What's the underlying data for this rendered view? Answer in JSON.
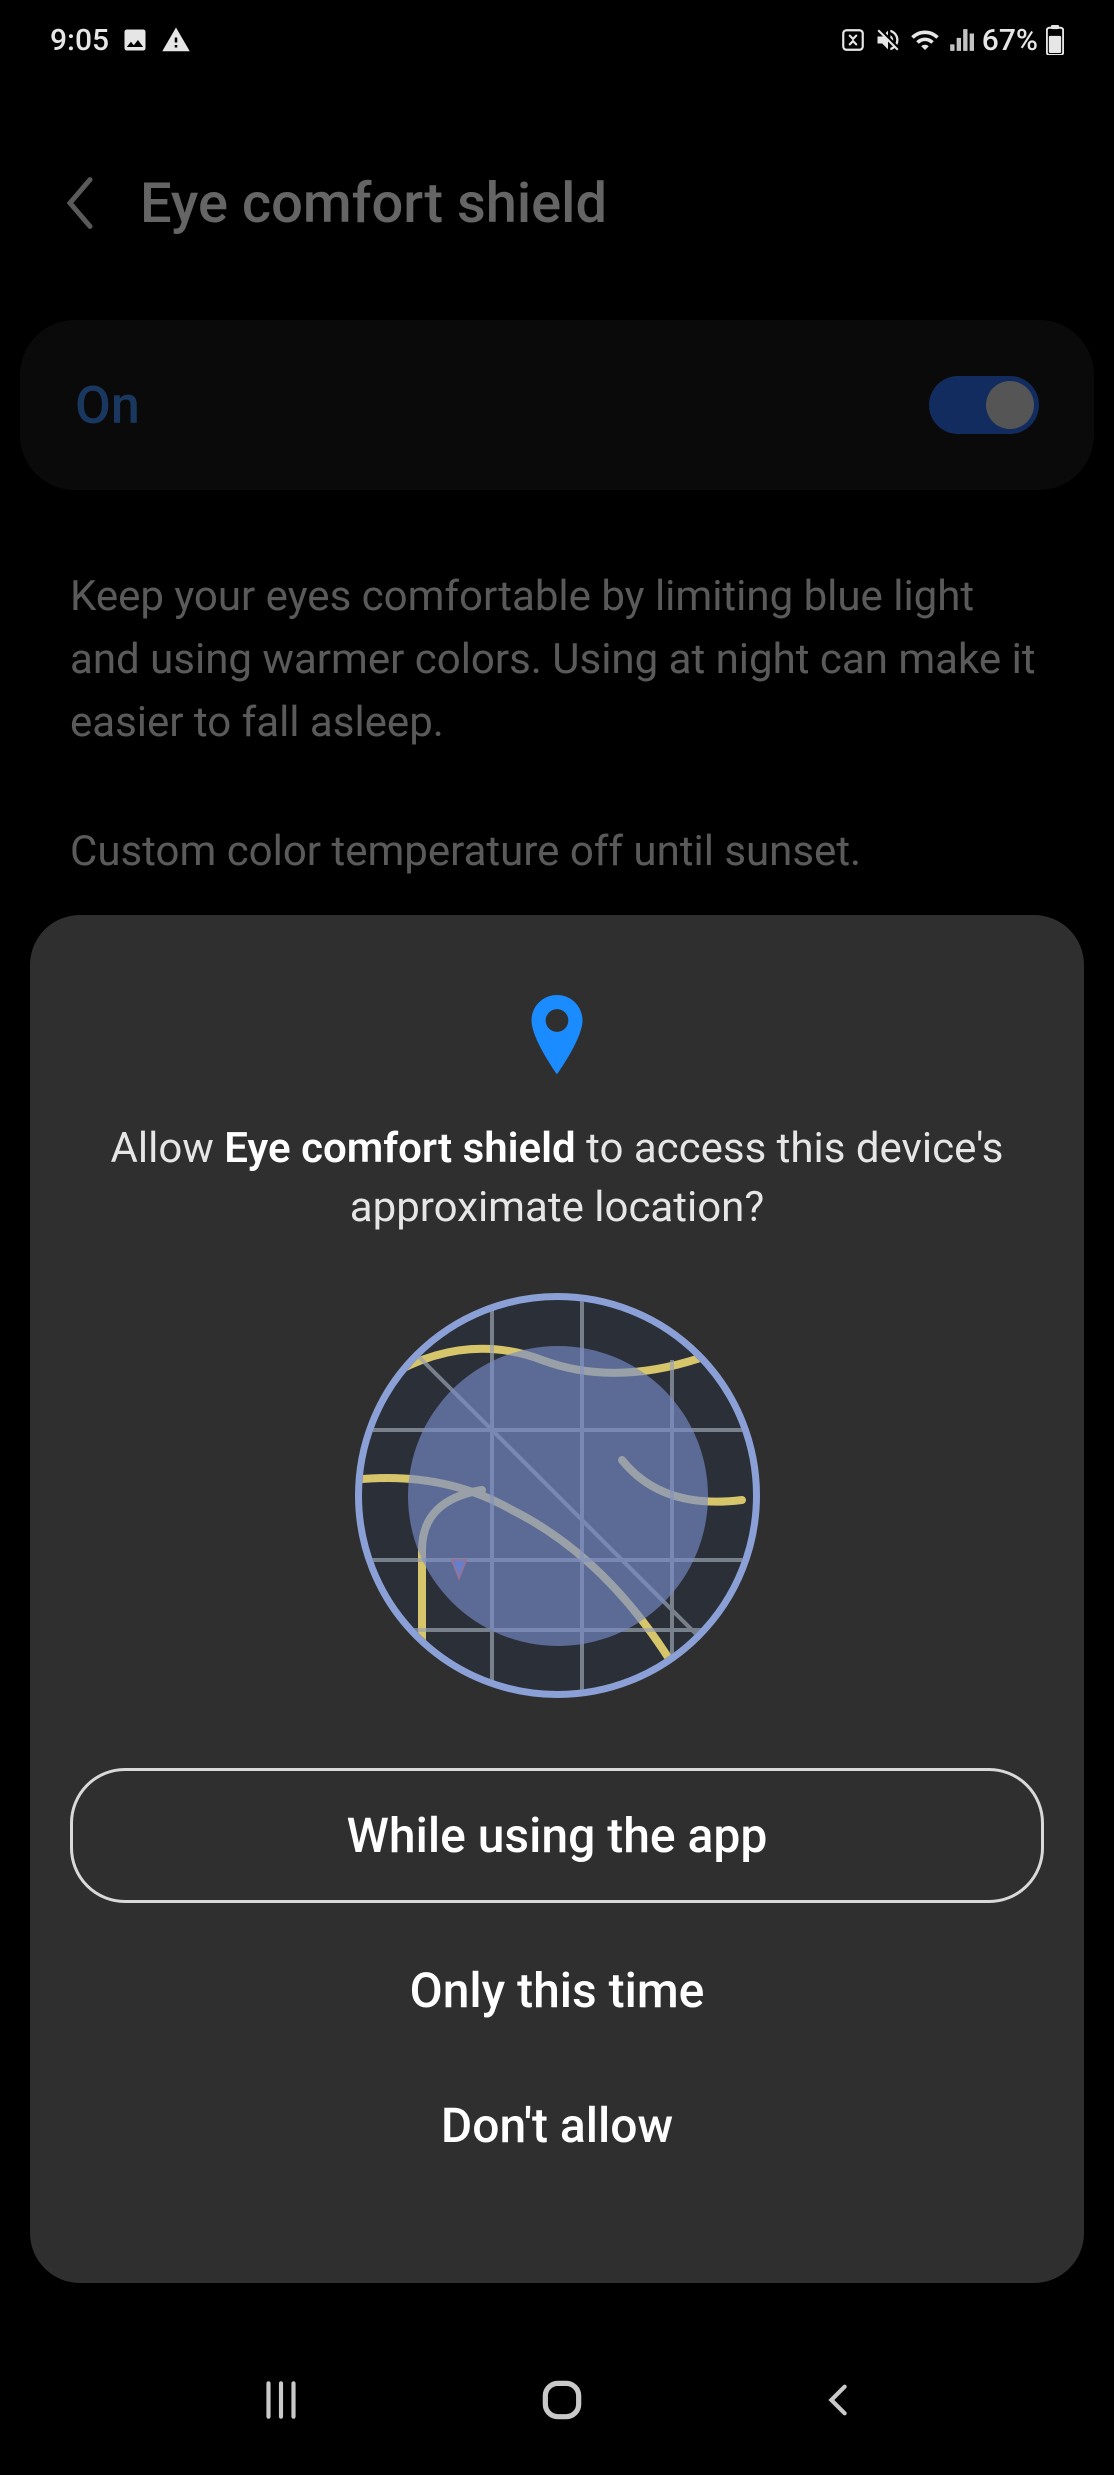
{
  "status": {
    "time": "9:05",
    "battery_pct": "67%"
  },
  "page": {
    "title": "Eye comfort shield",
    "toggle_label": "On",
    "desc1": "Keep your eyes comfortable by limiting blue light and using warmer colors. Using at night can make it easier to fall asleep.",
    "desc2": "Custom color temperature off until sunset."
  },
  "dialog": {
    "prompt_pre": "Allow ",
    "prompt_app": "Eye comfort shield",
    "prompt_post": " to access this device's approximate location?",
    "btn_primary": "While using the app",
    "btn_once": "Only this time",
    "btn_deny": "Don't allow"
  }
}
